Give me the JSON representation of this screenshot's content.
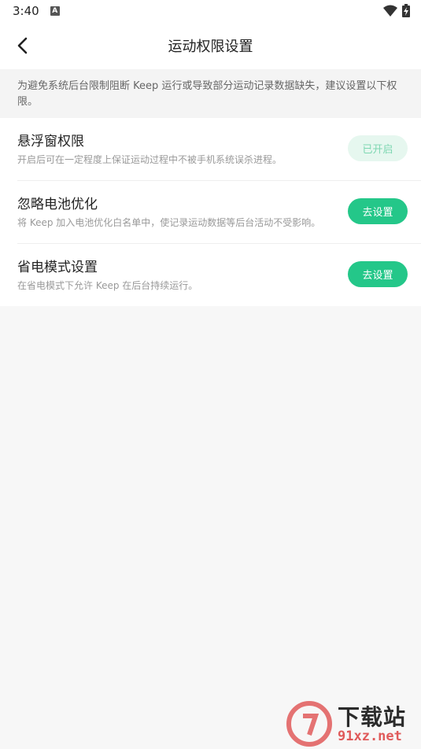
{
  "status": {
    "time": "3:40",
    "badge": "A"
  },
  "header": {
    "title": "运动权限设置"
  },
  "notice": "为避免系统后台限制阻断 Keep 运行或导致部分运动记录数据缺失，建议设置以下权限。",
  "items": [
    {
      "title": "悬浮窗权限",
      "desc": "开启后可在一定程度上保证运动过程中不被手机系统误杀进程。",
      "button": "已开启"
    },
    {
      "title": "忽略电池优化",
      "desc": "将 Keep 加入电池优化白名单中，使记录运动数据等后台活动不受影响。",
      "button": "去设置"
    },
    {
      "title": "省电模式设置",
      "desc": "在省电模式下允许 Keep 在后台持续运行。",
      "button": "去设置"
    }
  ],
  "watermark": {
    "text1": "下载站",
    "text2": "91xz.net"
  },
  "colors": {
    "accent": "#24c789",
    "accent_light": "#e6f7ef"
  }
}
